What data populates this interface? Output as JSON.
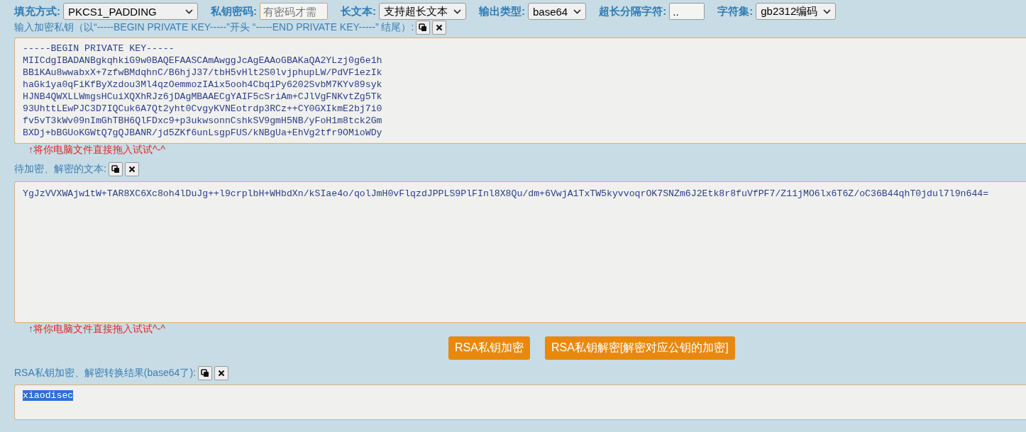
{
  "options": [
    {
      "label": "填充方式:",
      "kind": "select",
      "value": "PKCS1_PADDING"
    },
    {
      "label": "私钥密码:",
      "kind": "input",
      "placeholder": "有密码才需"
    },
    {
      "label": "长文本:",
      "kind": "select",
      "value": "支持超长文本"
    },
    {
      "label": "输出类型:",
      "kind": "select",
      "value": "base64"
    },
    {
      "label": "超长分隔字符:",
      "kind": "input",
      "value": ".."
    },
    {
      "label": "字符集:",
      "kind": "select",
      "value": "gb2312编码"
    }
  ],
  "sections": [
    {
      "kind": "textarea",
      "label": "输入加密私钥（以“-----BEGIN PRIVATE KEY-----”开头 “-----END PRIVATE KEY-----” 结尾）:",
      "lines": [
        "-----BEGIN PRIVATE KEY-----",
        "MIICdgIBADANBgkqhkiG9w0BAQEFAASCAmAwggJcAgEAAoGBAKaQA2YLzj0g6e1h",
        "BB1KAu8wwabxX+7zfwBMdqhnC/B6hjJ37/tbH5vHlt2S0lvjphupLW/PdVF1ezIk",
        "haGk1ya0qFiKfByXzdou3Ml4qzOemmozIAix5ooh4Cbq1Py6202SvbM7KYv89syk",
        "HJNB4QWXLLWmgsHCuiXQXhRJz6jDAgMBAAECgYAIF5cSriAm+CJlVgFNKvtZg5Tk",
        "93UhttLEwPJC3D7IQCuk6A7Qt2yht0CvgyKVNEotrdp3RCz++CY0GXIkmE2bj7i0",
        "fv5vT3kWv09nImGhTBH6QlFDxc9+p3ukwsonnCshkSV9gmH5NB/yFoH1m8tck2Gm",
        "BXDj+bBGUoKGWtQ7gQJBANR/jd5ZKf6unLsgpFUS/kNBgUa+EhVg2tfr9OMioWDy"
      ],
      "hint": "↑将你电脑文件直接拖入试试^-^"
    },
    {
      "kind": "textarea",
      "label": "待加密、解密的文本:",
      "lines": [
        "YgJzVVXWAjw1tW+TAR8XC6Xc8oh4lDuJg++l9crplbH+WHbdXn/kSIae4o/qolJmH0vFlqzdJPPLS9PlFInl8X8Qu/dm+6VwjA1TxTW5kyvvoqrOK7SNZm6J2Etk8r8fuVfPF7/Z11jMO6lx6T6Z/oC36B44qhT0jdul7l9n644="
      ],
      "hint": "↑将你电脑文件直接拖入试试^-^"
    },
    {
      "kind": "buttons",
      "buttons": [
        "RSA私钥加密",
        "RSA私钥解密[解密对应公钥的加密]"
      ]
    },
    {
      "kind": "textarea",
      "label": "RSA私钥加密、解密转换结果(base64了):",
      "lines": [
        "xiaodisec"
      ],
      "selected": true
    }
  ]
}
